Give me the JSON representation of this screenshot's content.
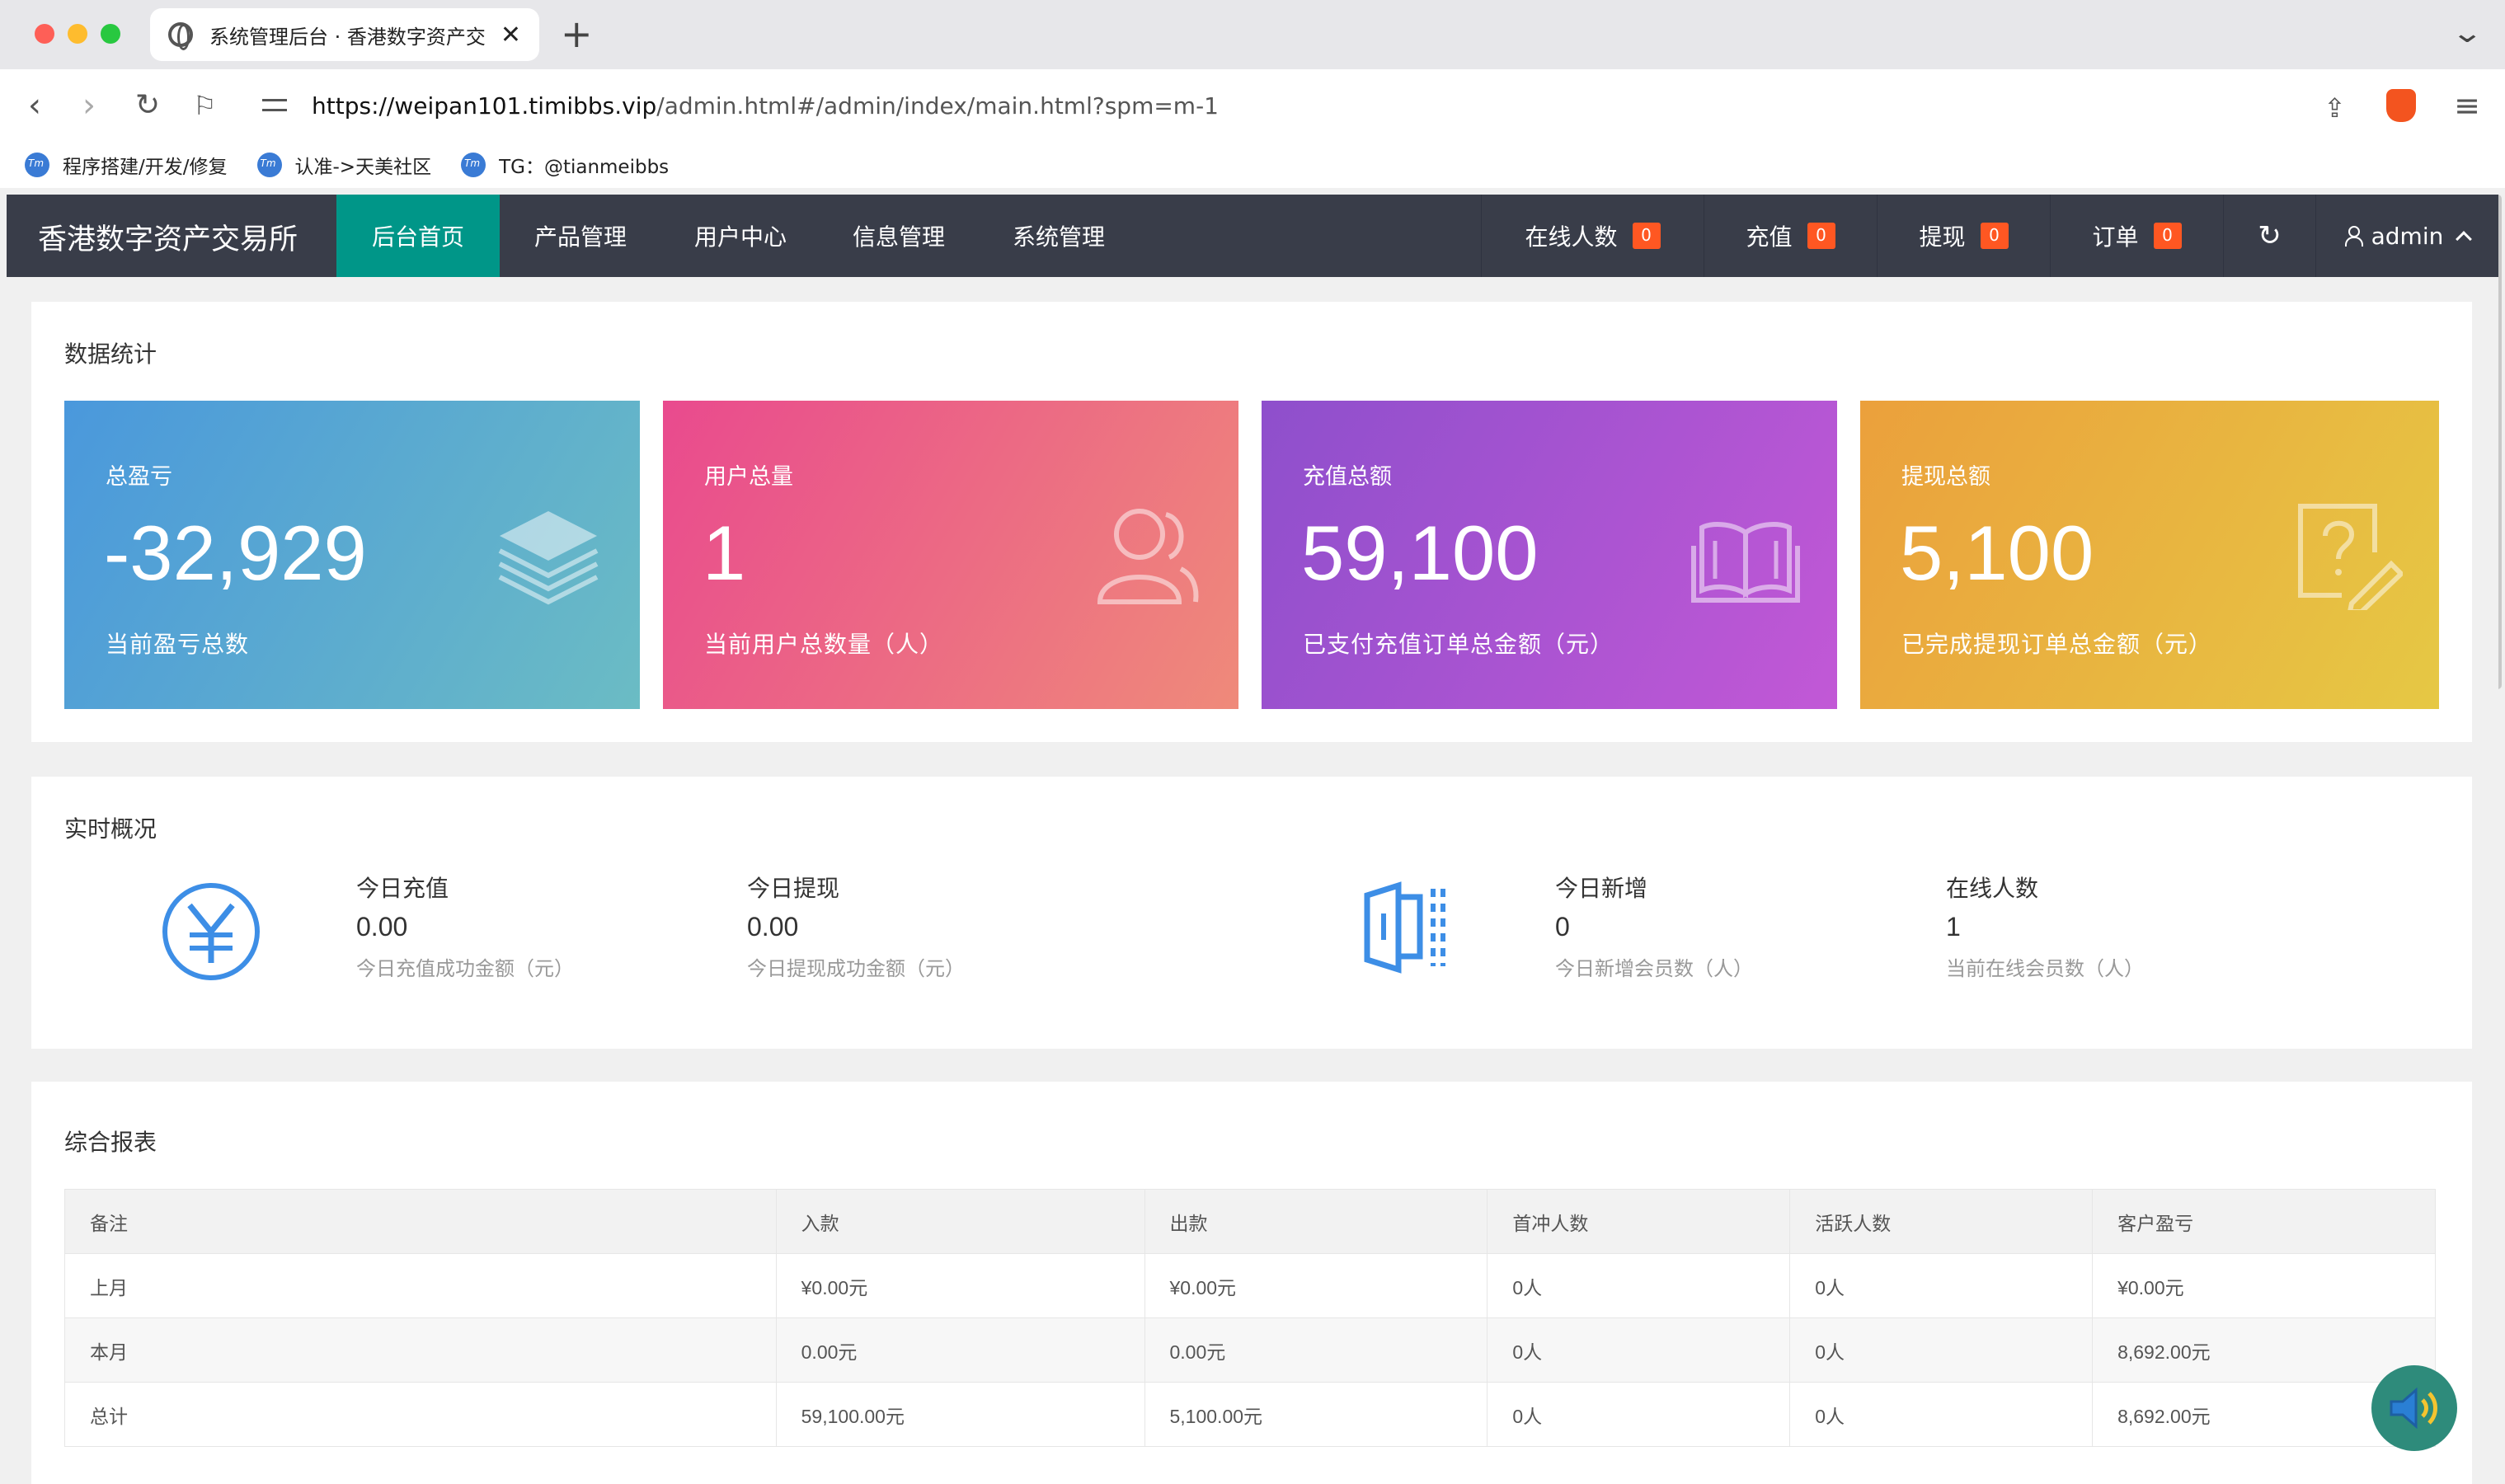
{
  "browser": {
    "tab_title": "系统管理后台 · 香港数字资产交",
    "url_host": "https://weipan101.timibbs.vip",
    "url_path": "/admin.html#/admin/index/main.html?spm=m-1",
    "bookmarks": [
      "程序搭建/开发/修复",
      "认准->天美社区",
      "TG：@tianmeibbs"
    ]
  },
  "header": {
    "logo": "香港数字资产交易所",
    "nav": [
      "后台首页",
      "产品管理",
      "用户中心",
      "信息管理",
      "系统管理"
    ],
    "right": [
      {
        "label": "在线人数",
        "count": "0"
      },
      {
        "label": "充值",
        "count": "0"
      },
      {
        "label": "提现",
        "count": "0"
      },
      {
        "label": "订单",
        "count": "0"
      }
    ],
    "user": "admin"
  },
  "stats": {
    "title": "数据统计",
    "cards": [
      {
        "label": "总盈亏",
        "value": "-32,929",
        "desc": "当前盈亏总数",
        "icon": "layers-icon"
      },
      {
        "label": "用户总量",
        "value": "1",
        "desc": "当前用户总数量（人）",
        "icon": "users-icon"
      },
      {
        "label": "充值总额",
        "value": "59,100",
        "desc": "已支付充值订单总金额（元）",
        "icon": "book-icon"
      },
      {
        "label": "提现总额",
        "value": "5,100",
        "desc": "已完成提现订单总金额（元）",
        "icon": "question-edit-icon"
      }
    ]
  },
  "realtime": {
    "title": "实时概况",
    "items": [
      {
        "label": "今日充值",
        "value": "0.00",
        "desc": "今日充值成功金额（元）"
      },
      {
        "label": "今日提现",
        "value": "0.00",
        "desc": "今日提现成功金额（元）"
      },
      {
        "label": "今日新增",
        "value": "0",
        "desc": "今日新增会员数（人）"
      },
      {
        "label": "在线人数",
        "value": "1",
        "desc": "当前在线会员数（人）"
      }
    ]
  },
  "report": {
    "title": "综合报表",
    "columns": [
      "备注",
      "入款",
      "出款",
      "首冲人数",
      "活跃人数",
      "客户盈亏"
    ],
    "rows": [
      [
        "上月",
        "¥0.00元",
        "¥0.00元",
        "0人",
        "0人",
        "¥0.00元"
      ],
      [
        "本月",
        "0.00元",
        "0.00元",
        "0人",
        "0人",
        "8,692.00元"
      ],
      [
        "总计",
        "59,100.00元",
        "5,100.00元",
        "0人",
        "0人",
        "8,692.00元"
      ]
    ]
  },
  "colors": {
    "header_bg": "#393d49",
    "nav_active": "#009688",
    "badge": "#ff5722",
    "card1": [
      "#4a98dc",
      "#6bbcc4"
    ],
    "card2": [
      "#e94a8e",
      "#ef8a7a"
    ],
    "card3": [
      "#8e4fcc",
      "#c258d6"
    ],
    "card4": [
      "#eba03c",
      "#e6c844"
    ],
    "icon_blue": "#3d8ee6"
  }
}
